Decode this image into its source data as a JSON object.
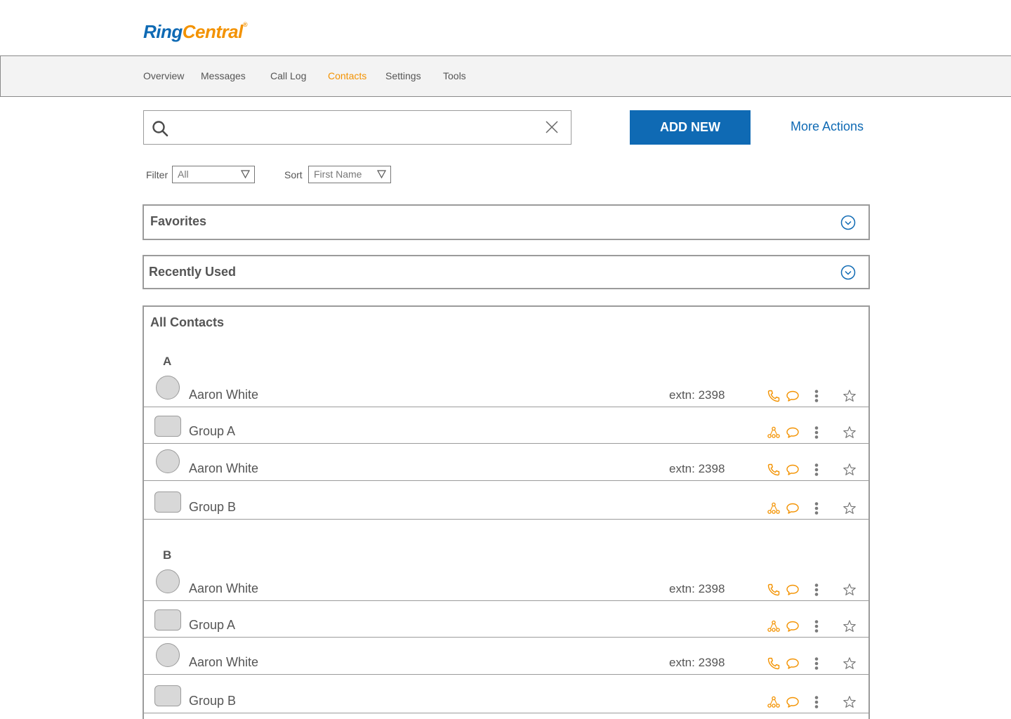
{
  "header": {
    "logo_ring": "Ring",
    "logo_central": "Central",
    "logo_reg": "®"
  },
  "nav": {
    "items": [
      "Overview",
      "Messages",
      "Call Log",
      "Contacts",
      "Settings",
      "Tools"
    ],
    "active": "Contacts"
  },
  "search": {
    "value": "",
    "placeholder": ""
  },
  "actions": {
    "add_new_label": "ADD NEW",
    "more_actions_label": "More Actions"
  },
  "filter": {
    "label": "Filter",
    "value": "All"
  },
  "sort": {
    "label": "Sort",
    "value": "First Name"
  },
  "sections": {
    "favorites": "Favorites",
    "recently_used": "Recently Used",
    "all_contacts": "All Contacts"
  },
  "groups": [
    {
      "letter": "A",
      "rows": [
        {
          "type": "contact",
          "name": "Aaron White",
          "extn": "extn: 2398"
        },
        {
          "type": "group",
          "name": "Group A",
          "extn": ""
        },
        {
          "type": "contact",
          "name": "Aaron White",
          "extn": "extn: 2398"
        },
        {
          "type": "group",
          "name": "Group B",
          "extn": ""
        }
      ]
    },
    {
      "letter": "B",
      "rows": [
        {
          "type": "contact",
          "name": "Aaron White",
          "extn": "extn: 2398"
        },
        {
          "type": "group",
          "name": "Group A",
          "extn": ""
        },
        {
          "type": "contact",
          "name": "Aaron White",
          "extn": "extn: 2398"
        },
        {
          "type": "group",
          "name": "Group B",
          "extn": ""
        }
      ]
    }
  ],
  "colors": {
    "brand_blue": "#0f6ab4",
    "brand_orange": "#f39200",
    "border_gray": "#9b9b9b"
  },
  "icons": {
    "row_contact": [
      "phone-icon",
      "message-icon",
      "more-vertical-icon",
      "star-icon"
    ],
    "row_group": [
      "group-icon",
      "message-icon",
      "more-vertical-icon",
      "star-icon"
    ]
  }
}
